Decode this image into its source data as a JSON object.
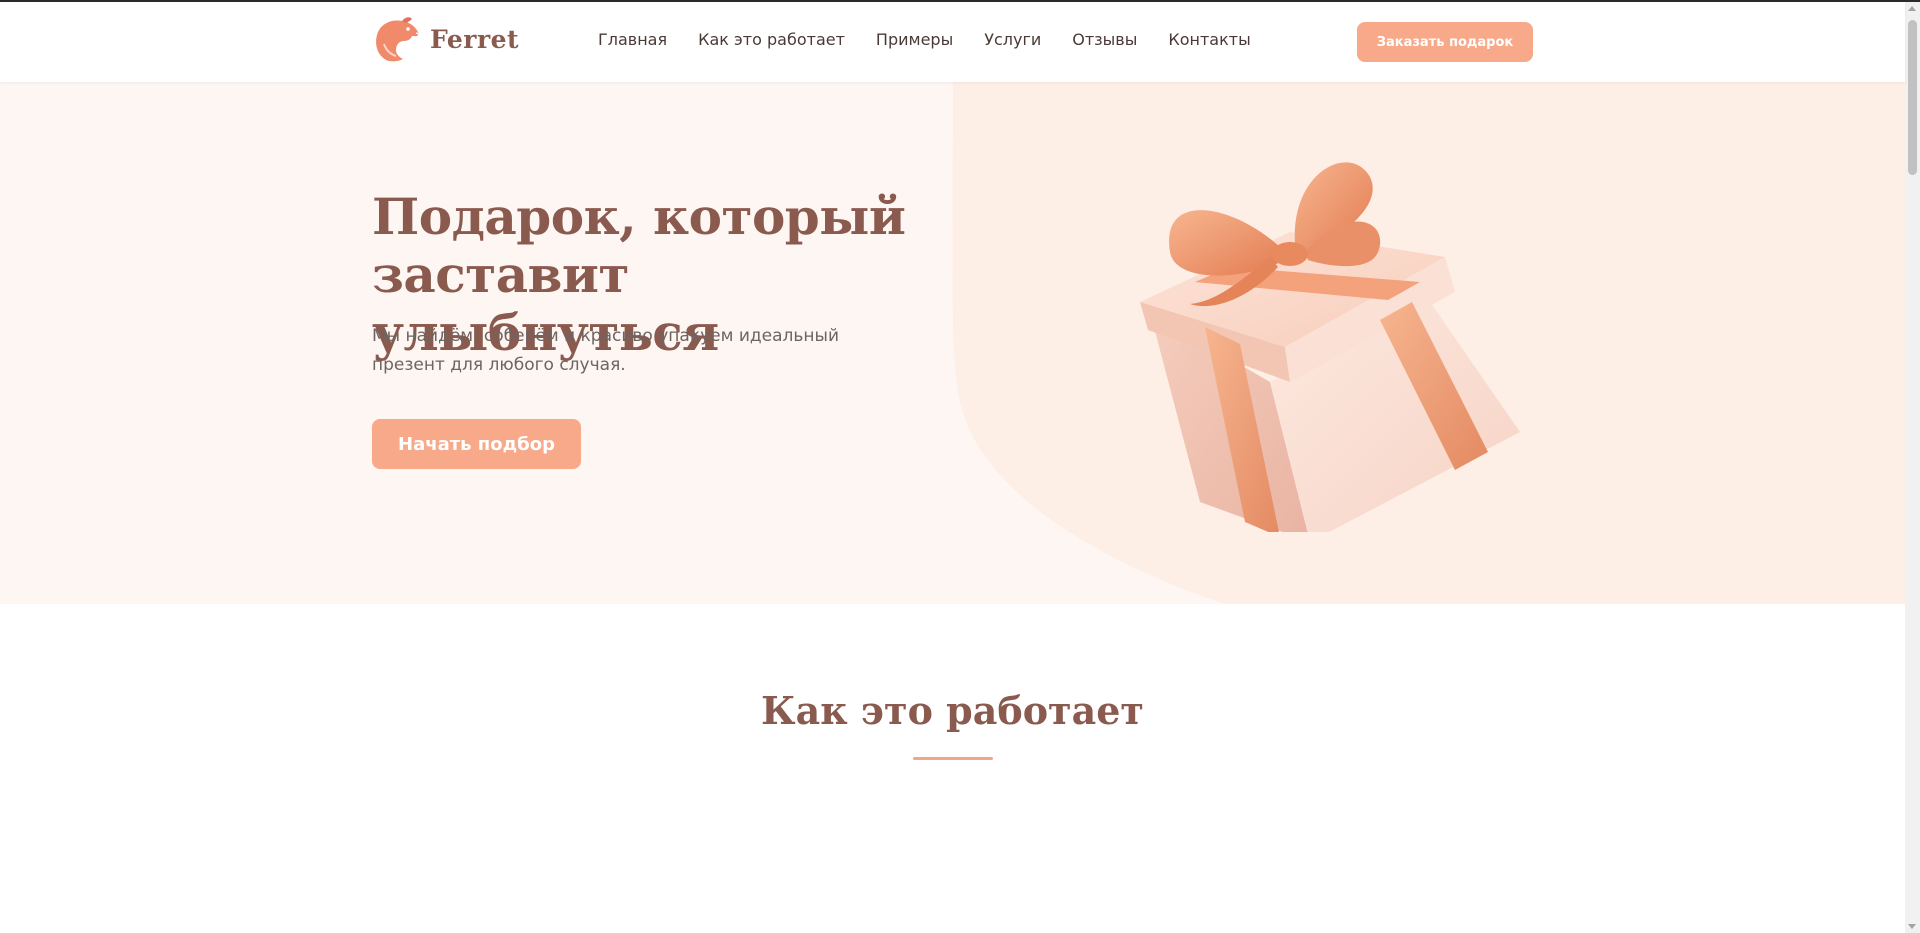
{
  "brand": {
    "name": "Ferret",
    "logo_icon": "ferret-head-icon"
  },
  "nav": {
    "items": [
      {
        "label": "Главная"
      },
      {
        "label": "Как это работает"
      },
      {
        "label": "Примеры"
      },
      {
        "label": "Услуги"
      },
      {
        "label": "Отзывы"
      },
      {
        "label": "Контакты"
      }
    ],
    "cta_label": "Заказать подарок"
  },
  "hero": {
    "title_line1": "Подарок, который",
    "title_line2": "заставит улыбнуться",
    "subtitle": "Мы найдём, соберём и красиво упакуем идеальный презент для любого случая.",
    "button_label": "Начать подбор",
    "image_icon": "gift-box-icon"
  },
  "section": {
    "title": "Как это работает"
  },
  "colors": {
    "accent": "#f7a98a",
    "heading": "#8a5a4e",
    "hero_bg": "#fdf6f2",
    "hero_shape": "#fdeee6"
  }
}
